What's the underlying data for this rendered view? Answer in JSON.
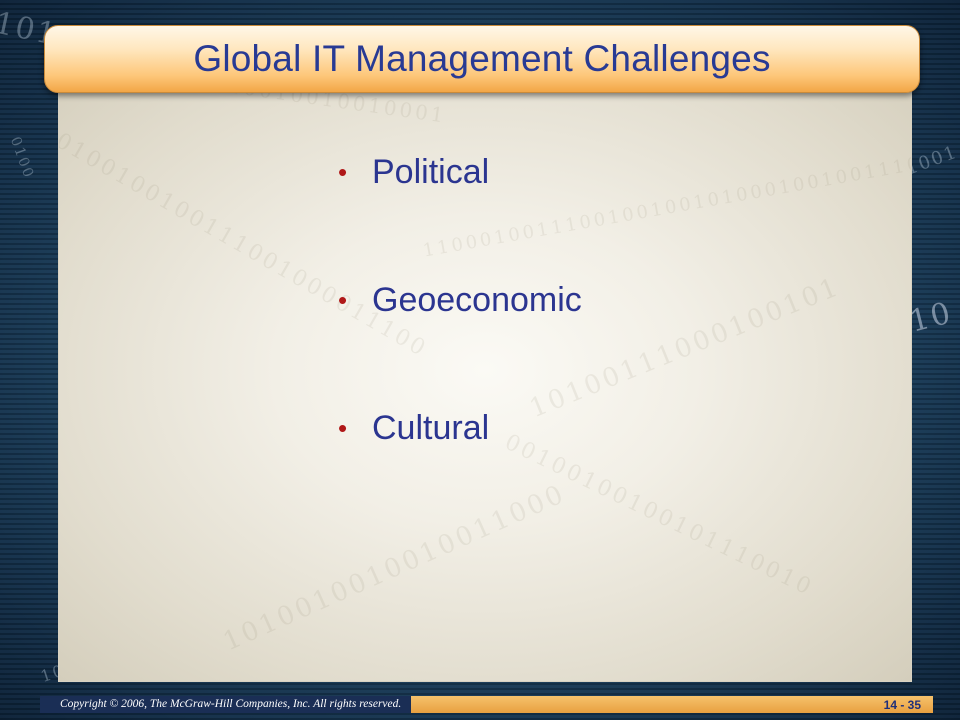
{
  "slide": {
    "title": "Global IT Management Challenges",
    "bullets": [
      {
        "label": "Political"
      },
      {
        "label": "Geoeconomic"
      },
      {
        "label": "Cultural"
      }
    ],
    "footer": {
      "copyright": "Copyright © 2006, The McGraw-Hill Companies, Inc. All rights reserved.",
      "slide_number": "14 - 35"
    }
  },
  "colors": {
    "title_text": "#283a94",
    "bullet_text": "#2b3590",
    "bullet_marker": "#b01818",
    "title_bar": "#fdc77a",
    "background": "#1f4666"
  }
}
